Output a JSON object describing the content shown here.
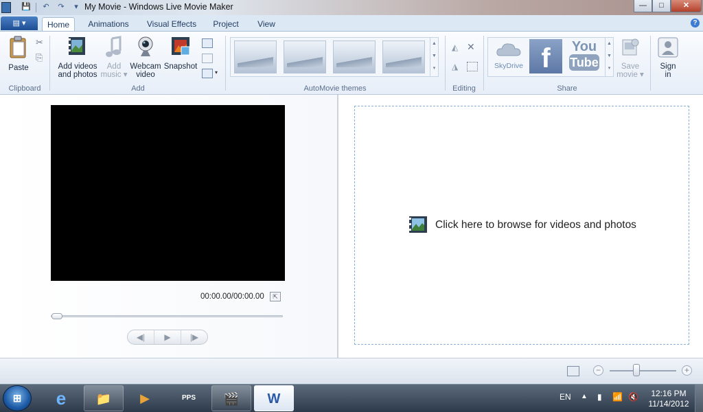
{
  "window": {
    "title": "My Movie - Windows Live Movie Maker",
    "minimize": "—",
    "maximize": "□",
    "close": "✕"
  },
  "qat": {
    "save": "💾",
    "undo": "↶",
    "redo": "↷",
    "customize": "▾"
  },
  "ribbon_tabs": [
    {
      "label": "Home",
      "active": true
    },
    {
      "label": "Animations"
    },
    {
      "label": "Visual Effects"
    },
    {
      "label": "Project"
    },
    {
      "label": "View"
    }
  ],
  "app_menu": "▤ ▾",
  "help": "?",
  "groups": {
    "clipboard": {
      "label": "Clipboard",
      "paste": "Paste",
      "cut_icon": "✂",
      "copy_icon": "⎘"
    },
    "add": {
      "label": "Add",
      "add_videos": "Add videos and photos",
      "add_music_1": "Add",
      "add_music_2": "music ▾",
      "webcam_1": "Webcam",
      "webcam_2": "video",
      "snapshot": "Snapshot"
    },
    "automovie": {
      "label": "AutoMovie themes"
    },
    "editing": {
      "label": "Editing"
    },
    "share": {
      "label": "Share",
      "skydrive": "SkyDrive",
      "facebook": "f",
      "youtube_1": "You",
      "youtube_2": "Tube",
      "save_movie_1": "Save",
      "save_movie_2": "movie ▾",
      "sign_in_1": "Sign",
      "sign_in_2": "in"
    }
  },
  "preview": {
    "timecode": "00:00.00/00:00.00",
    "controls": [
      "◀|",
      "▶",
      "|▶"
    ],
    "seek_fraction": 0
  },
  "storyboard": {
    "cta": "Click here to browse for videos and photos"
  },
  "status": {
    "zoom_minus": "−",
    "zoom_plus": "+"
  },
  "taskbar": {
    "start": "⊞",
    "apps": [
      "e",
      "📁",
      "▶",
      "PPS",
      "🎬",
      "W"
    ],
    "lang": "EN",
    "time": "12:16 PM",
    "date": "11/14/2012"
  },
  "colors": {
    "accent": "#1d4d94",
    "dashed_border": "#88aedb",
    "facebook": "#3b5998"
  }
}
